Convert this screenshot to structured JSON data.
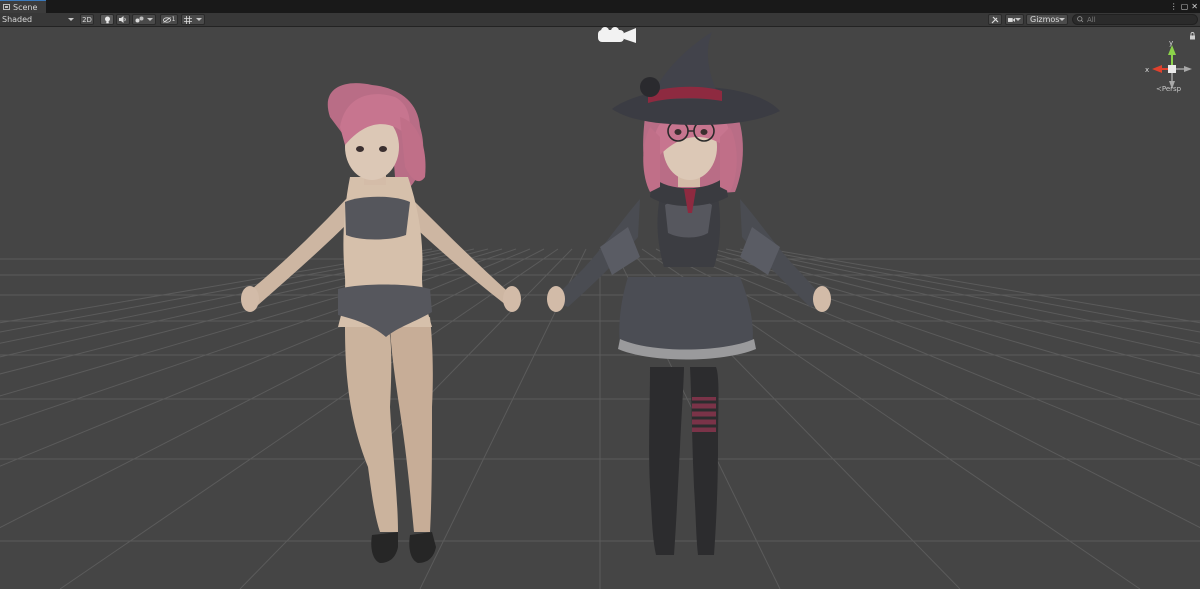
{
  "window": {
    "tab_title": "Scene"
  },
  "toolbar": {
    "draw_mode": "Shaded",
    "mode_2d_label": "2D",
    "light_icon": "lightbulb-icon",
    "audio_icon": "speaker-icon",
    "effects_icon": "effects-icon",
    "hidden_count_label": "1",
    "grid_icon": "grid-icon",
    "tools_icon": "tools-icon",
    "camera_icon": "camera-icon",
    "gizmos_label": "Gizmos",
    "search_placeholder": "All"
  },
  "orientation_gizmo": {
    "y_label": "y",
    "x_label": "x",
    "projection_label": "Persp"
  },
  "colors": {
    "viewport_bg": "#454545",
    "grid_line": "#595959",
    "axis_x": "#e0412d",
    "axis_y": "#8bd24a",
    "axis_z": "#3b7de0"
  }
}
